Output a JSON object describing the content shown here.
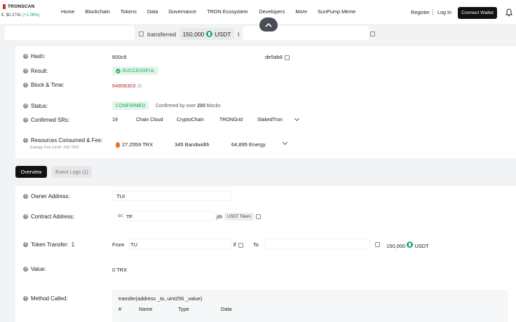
{
  "header": {
    "logo_text": "TRONSCAN",
    "price": "$0.2741",
    "price_change": "(+1.08%)",
    "nav": [
      "Home",
      "Blockchain",
      "Tokens",
      "Data",
      "Governance",
      "TRON Ecosystem",
      "Developers",
      "More",
      "SunPump Meme"
    ],
    "register": "Register",
    "login": "Log In",
    "connect_wallet": "Connect Wallet"
  },
  "summary": {
    "verb": "transferred",
    "amount": "150,000",
    "token": "USDT",
    "to": "t"
  },
  "details": {
    "hash_label": "Hash:",
    "hash_start": "600c9",
    "hash_end": "de5ab6",
    "result_label": "Result:",
    "result_value": "SUCCESSFUL",
    "block_label": "Block & Time:",
    "block_value": "64808303",
    "status_label": "Status:",
    "status_value": "CONFIRMED",
    "status_note_prefix": "Confirmed by over",
    "status_note_count": "200",
    "status_note_suffix": "blocks",
    "srs_label": "Confirmed SRs:",
    "srs_count": "19",
    "srs": [
      "Chain Cloud",
      "CryptoChain",
      "TRONGrid",
      "StakedTron"
    ],
    "resources_label": "Resources Consumed & Fee:",
    "fee_limit": "Energy Fee Limit: 100 TRX",
    "trx_amount": "27.2559",
    "trx_unit": "TRX",
    "bandwidth_amount": "345",
    "bandwidth_unit": "Bandwidth",
    "energy_amount": "64,895",
    "energy_unit": "Energy"
  },
  "tabs": {
    "overview": "Overview",
    "event_logs": "Event Logs (1)"
  },
  "overview": {
    "owner_label": "Owner Address:",
    "owner_value": "TUI",
    "contract_label": "Contract Address:",
    "contract_prefix": "sc",
    "contract_value": "TF",
    "contract_suffix": "j6t",
    "contract_tag": "USDT Token",
    "transfer_label": "Token Transfer:",
    "transfer_count": "1",
    "from_label": "From",
    "from_value": "TU",
    "from_suffix": "lf",
    "to_label": "To",
    "transfer_amount": "150,000",
    "transfer_token": "USDT",
    "value_label": "Value:",
    "value_value": "0 TRX",
    "method_label": "Method Called:",
    "method_signature": "transfer(address _to, uint256 _value)",
    "method_columns": [
      "#",
      "Name",
      "Type",
      "Data"
    ]
  },
  "colors": {
    "accent": "#b5312c",
    "success": "#1aa760",
    "success_bg": "#e3f6ea",
    "usdt": "#26a17b"
  }
}
